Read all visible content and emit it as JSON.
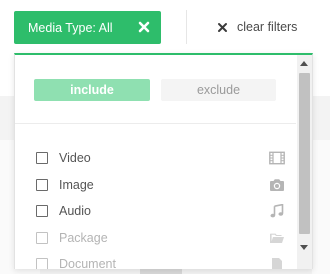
{
  "filter_chip": {
    "label": "Media Type: All",
    "close_icon": "close-x-icon",
    "color": "#2ebd6b"
  },
  "clear_filters": {
    "label": "clear filters",
    "icon": "close-x-icon"
  },
  "mode_toggle": {
    "include_label": "include",
    "exclude_label": "exclude",
    "selected": "include"
  },
  "options": [
    {
      "label": "Video",
      "icon": "film-icon",
      "checked": false,
      "disabled": false
    },
    {
      "label": "Image",
      "icon": "camera-icon",
      "checked": false,
      "disabled": false
    },
    {
      "label": "Audio",
      "icon": "music-note-icon",
      "checked": false,
      "disabled": false
    },
    {
      "label": "Package",
      "icon": "folder-icon",
      "checked": false,
      "disabled": true
    },
    {
      "label": "Document",
      "icon": "document-icon",
      "checked": false,
      "disabled": true
    }
  ]
}
